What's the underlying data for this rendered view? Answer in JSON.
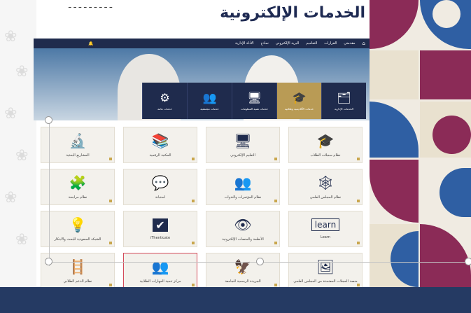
{
  "page": {
    "title": "الخدمات الإلكترونية",
    "title_partial": "ـ ـ ـ ـ ـ ـ ـ ـ ـ"
  },
  "navbar": {
    "items": [
      "مقدمتي",
      "القرارات",
      "التعاميم",
      "البريد الإلكتروني",
      "نماذج",
      "الأدلة الإدارية"
    ]
  },
  "service_bar": {
    "items": [
      {
        "label": "الخدمات الإدارية",
        "icon": "🗂"
      },
      {
        "label": "خدمات الأكاديمية وطلابية",
        "icon": "🎓"
      },
      {
        "label": "خدمات تقنية المعلومات",
        "icon": "🖥"
      },
      {
        "label": "خدمات مجتمعية",
        "icon": "👥"
      },
      {
        "label": "خدمات عامة",
        "icon": "⚙"
      }
    ]
  },
  "cards": [
    {
      "label": "نظام سجلات الطلاب",
      "icon": "🎓"
    },
    {
      "label": "التعليم الإلكتروني",
      "icon": "🖥"
    },
    {
      "label": "المكتبة الرقمية",
      "icon": "📚"
    },
    {
      "label": "المشاريع البحثية",
      "icon": "🔬"
    },
    {
      "label": "نظام المجلس العلمي",
      "icon": "🕸"
    },
    {
      "label": "نظام المؤتمرات والندوات",
      "icon": "👥"
    },
    {
      "label": "استبانة",
      "icon": "💬"
    },
    {
      "label": "نظام مراجعة",
      "icon": "🧩"
    },
    {
      "label": "Learn",
      "icon": "learn"
    },
    {
      "label": "الأنظمة والمنصات الإلكترونية",
      "icon": "👁"
    },
    {
      "label": "iThenticate",
      "icon": "✔"
    },
    {
      "label": "الشبكة السعودية للبحث والابتكار",
      "icon": "💡"
    },
    {
      "label": "منصة المجلات المعتمدة من المجلس العلمي",
      "icon": "🖼"
    },
    {
      "label": "الجريدة الرسمية للجامعة",
      "icon": "🦅"
    },
    {
      "label": "مركز تنمية المهارات الطلابية",
      "icon": "👥"
    },
    {
      "label": "نظام الدعم الطلابي",
      "icon": "🪜"
    }
  ]
}
